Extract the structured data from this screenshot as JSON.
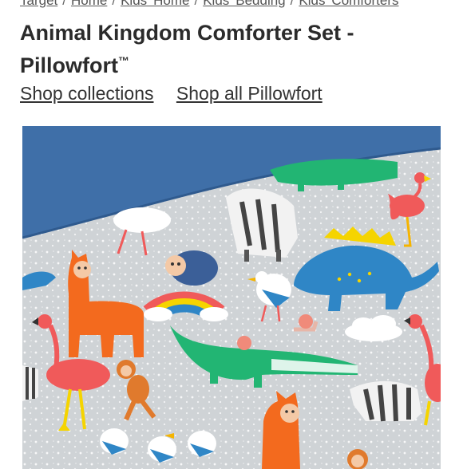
{
  "breadcrumb": {
    "items": [
      "Target",
      "Home",
      "Kids' Home",
      "Kids' Bedding",
      "Kids' Comforters"
    ],
    "separator": "/"
  },
  "product": {
    "title": "Animal Kingdom Comforter Set - Pillowfort",
    "trademark": "™"
  },
  "links": {
    "shop_collections": "Shop collections",
    "shop_all": "Shop all Pillowfort"
  },
  "image": {
    "subject": "comforter-photo",
    "colors": {
      "fold_blue": "#3f6fa8",
      "fabric_gray": "#cfd3d6",
      "llama_orange": "#f36a1e",
      "croc_green": "#22b573",
      "dino_blue": "#2f86c6",
      "flamingo_pink": "#f05a5a",
      "yellow": "#f5d400"
    }
  }
}
